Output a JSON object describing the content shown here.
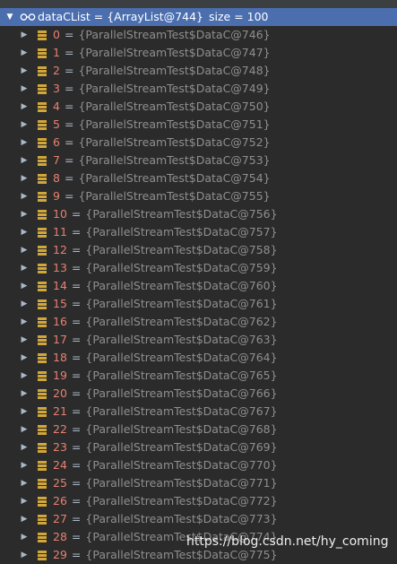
{
  "root": {
    "name": "dataCList",
    "equals": "=",
    "value": "{ArrayList@744}",
    "size_text": "size = 100"
  },
  "items": [
    {
      "index": "0",
      "value": "{ParallelStreamTest$DataC@746}"
    },
    {
      "index": "1",
      "value": "{ParallelStreamTest$DataC@747}"
    },
    {
      "index": "2",
      "value": "{ParallelStreamTest$DataC@748}"
    },
    {
      "index": "3",
      "value": "{ParallelStreamTest$DataC@749}"
    },
    {
      "index": "4",
      "value": "{ParallelStreamTest$DataC@750}"
    },
    {
      "index": "5",
      "value": "{ParallelStreamTest$DataC@751}"
    },
    {
      "index": "6",
      "value": "{ParallelStreamTest$DataC@752}"
    },
    {
      "index": "7",
      "value": "{ParallelStreamTest$DataC@753}"
    },
    {
      "index": "8",
      "value": "{ParallelStreamTest$DataC@754}"
    },
    {
      "index": "9",
      "value": "{ParallelStreamTest$DataC@755}"
    },
    {
      "index": "10",
      "value": "{ParallelStreamTest$DataC@756}"
    },
    {
      "index": "11",
      "value": "{ParallelStreamTest$DataC@757}"
    },
    {
      "index": "12",
      "value": "{ParallelStreamTest$DataC@758}"
    },
    {
      "index": "13",
      "value": "{ParallelStreamTest$DataC@759}"
    },
    {
      "index": "14",
      "value": "{ParallelStreamTest$DataC@760}"
    },
    {
      "index": "15",
      "value": "{ParallelStreamTest$DataC@761}"
    },
    {
      "index": "16",
      "value": "{ParallelStreamTest$DataC@762}"
    },
    {
      "index": "17",
      "value": "{ParallelStreamTest$DataC@763}"
    },
    {
      "index": "18",
      "value": "{ParallelStreamTest$DataC@764}"
    },
    {
      "index": "19",
      "value": "{ParallelStreamTest$DataC@765}"
    },
    {
      "index": "20",
      "value": "{ParallelStreamTest$DataC@766}"
    },
    {
      "index": "21",
      "value": "{ParallelStreamTest$DataC@767}"
    },
    {
      "index": "22",
      "value": "{ParallelStreamTest$DataC@768}"
    },
    {
      "index": "23",
      "value": "{ParallelStreamTest$DataC@769}"
    },
    {
      "index": "24",
      "value": "{ParallelStreamTest$DataC@770}"
    },
    {
      "index": "25",
      "value": "{ParallelStreamTest$DataC@771}"
    },
    {
      "index": "26",
      "value": "{ParallelStreamTest$DataC@772}"
    },
    {
      "index": "27",
      "value": "{ParallelStreamTest$DataC@773}"
    },
    {
      "index": "28",
      "value": "{ParallelStreamTest$DataC@774}"
    },
    {
      "index": "29",
      "value": "{ParallelStreamTest$DataC@775}"
    }
  ],
  "icons": {
    "root": "watch-glasses-icon",
    "item": "object-fields-icon",
    "expanded": "expanded-arrow-icon",
    "collapsed": "collapsed-arrow-icon"
  },
  "colors": {
    "background": "#2b2b2b",
    "selection": "#4b6eaf",
    "index": "#e8806f",
    "object_text": "#8e8f91",
    "field_icon": "#d1a63b"
  },
  "watermark": "https://blog.csdn.net/hy_coming"
}
